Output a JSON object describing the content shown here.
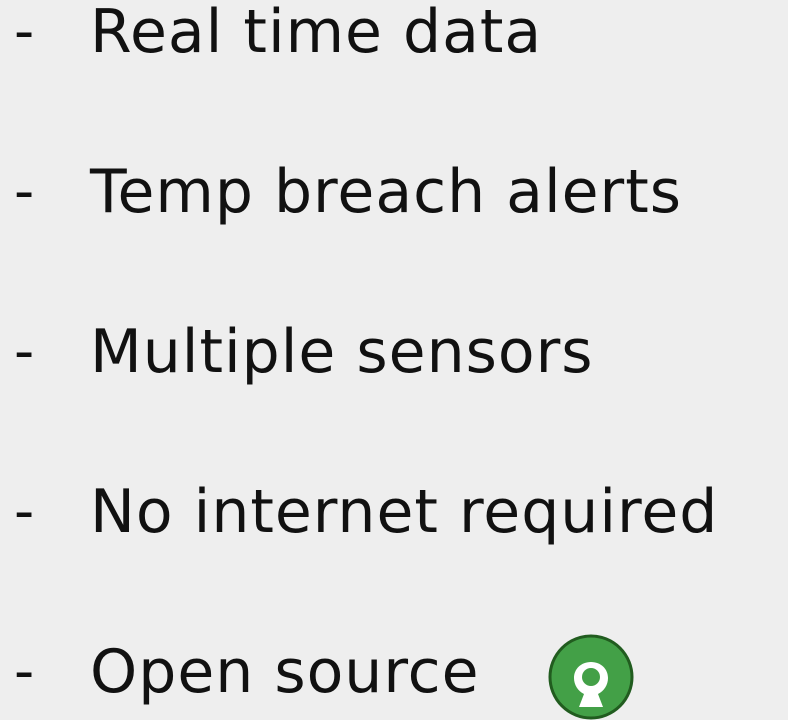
{
  "bullet_marker": "-",
  "items": [
    {
      "label": "Real time data"
    },
    {
      "label": "Temp breach alerts"
    },
    {
      "label": "Multiple sensors"
    },
    {
      "label": "No internet required"
    },
    {
      "label": "Open source",
      "icon": "open-source-icon"
    }
  ],
  "icon_colors": {
    "fill": "#43a047",
    "stroke": "#215c1f",
    "hole": "#ffffff"
  }
}
